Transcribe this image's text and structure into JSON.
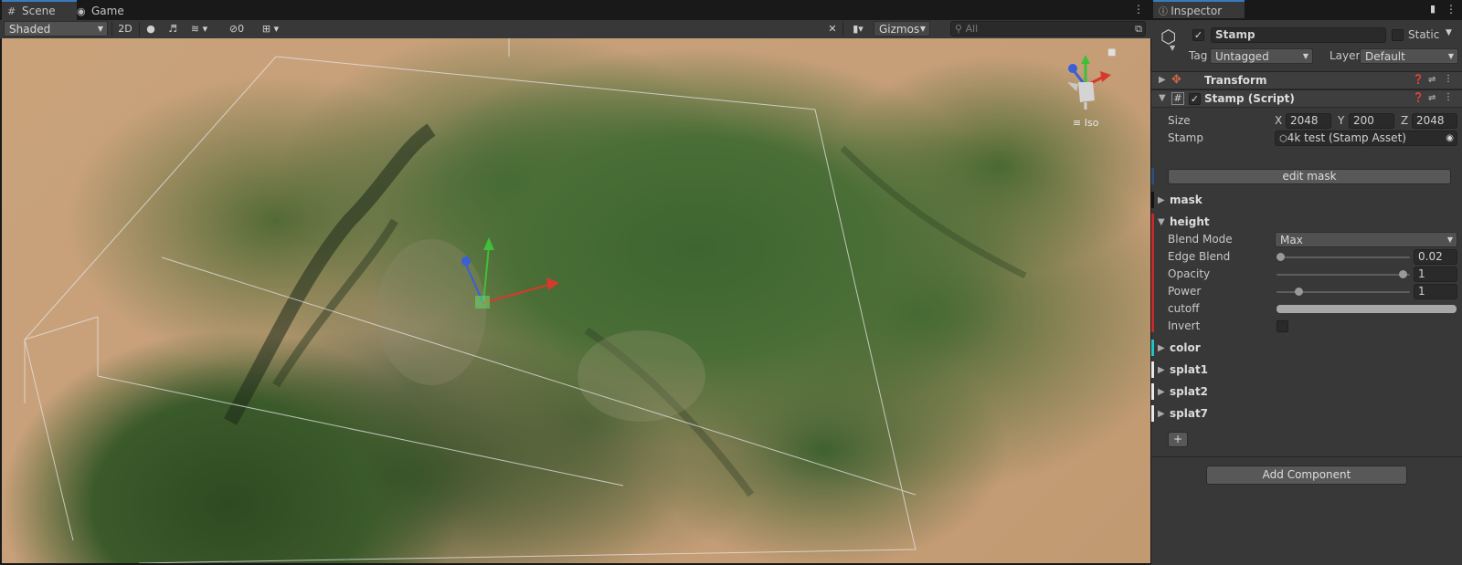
{
  "tabs": {
    "scene": "Scene",
    "game": "Game",
    "inspector": "Inspector"
  },
  "toolbar": {
    "shading_mode": "Shaded",
    "mode_2d": "2D",
    "hidden_count": "0",
    "gizmos": "Gizmos",
    "search_placeholder": "All"
  },
  "viewport": {
    "projection_label": "Iso"
  },
  "inspector": {
    "object_name": "Stamp",
    "static_label": "Static",
    "tag_label": "Tag",
    "tag_value": "Untagged",
    "layer_label": "Layer",
    "layer_value": "Default",
    "components": {
      "transform": "Transform",
      "stamp_script": "Stamp (Script)"
    },
    "size_label": "Size",
    "size": {
      "x_label": "X",
      "x": "2048",
      "y_label": "Y",
      "y": "200",
      "z_label": "Z",
      "z": "2048"
    },
    "stamp_label": "Stamp",
    "stamp_value": "4k test (Stamp Asset)",
    "edit_mask": "edit mask",
    "sections": {
      "mask": "mask",
      "height": "height",
      "color": "color",
      "splat1": "splat1",
      "splat2": "splat2",
      "splat7": "splat7"
    },
    "blend_mode_label": "Blend Mode",
    "blend_mode_value": "Max",
    "edge_blend_label": "Edge Blend",
    "edge_blend_value": "0.02",
    "opacity_label": "Opacity",
    "opacity_value": "1",
    "power_label": "Power",
    "power_value": "1",
    "cutoff_label": "cutoff",
    "invert_label": "Invert",
    "add_layer": "+",
    "add_component": "Add Component"
  },
  "colors": {
    "accent_blue": "#3a79bb",
    "mask_bar": "#1a1a1a",
    "height_bar": "#c22c2c",
    "color_bar": "#22c3c8",
    "splat_bar": "#e8e8e8",
    "gizmo_x": "#d63a2a",
    "gizmo_y": "#3fbf3a",
    "gizmo_z": "#3a5fd6"
  }
}
